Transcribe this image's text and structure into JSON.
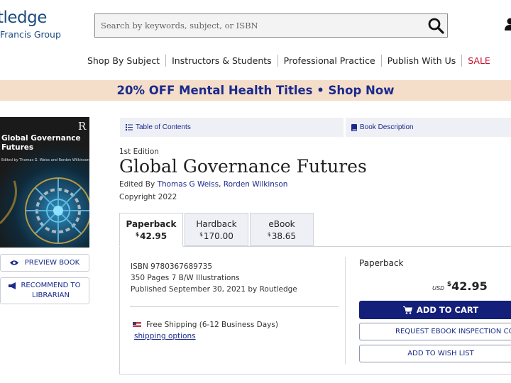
{
  "header": {
    "logo_text": "tledge",
    "logo_sub": "Francis Group",
    "search_placeholder": "Search by keywords, subject, or ISBN"
  },
  "nav": {
    "items": [
      "Shop By Subject",
      "Instructors & Students",
      "Professional Practice",
      "Publish With Us",
      "SALE"
    ]
  },
  "promo": {
    "text": "20% OFF Mental Health Titles • Shop Now"
  },
  "cover": {
    "title": "Global Governance Futures",
    "editors": "Edited by Thomas G. Weiss and Rorden Wilkinson",
    "publisher_mark": "R"
  },
  "sidebar": {
    "preview_label": "PREVIEW BOOK",
    "recommend_line1": "RECOMMEND TO",
    "recommend_line2": "LIBRARIAN"
  },
  "tabs": {
    "toc_label": "Table of Contents",
    "desc_label": "Book Description"
  },
  "book": {
    "edition": "1st Edition",
    "title": "Global Governance Futures",
    "edited_by_prefix": "Edited By",
    "editor1": "Thomas G Weiss",
    "editor_sep": ",",
    "editor2": "Rorden Wilkinson",
    "copyright": "Copyright 2022"
  },
  "formats": [
    {
      "name": "Paperback",
      "currency": "$",
      "price": "42.95",
      "selected": true
    },
    {
      "name": "Hardback",
      "currency": "$",
      "price": "170.00",
      "selected": false
    },
    {
      "name": "eBook",
      "currency": "$",
      "price": "38.65",
      "selected": false
    }
  ],
  "details": {
    "isbn": "ISBN 9780367689735",
    "pages": "350 Pages 7 B/W Illustrations",
    "published": "Published September 30, 2021 by Routledge",
    "shipping": "Free Shipping (6-12 Business Days)",
    "shipping_link": "shipping options"
  },
  "purchase": {
    "format_label": "Paperback",
    "currency_code": "USD",
    "currency_symbol": "$",
    "price": "42.95",
    "add_to_cart": "ADD TO CART",
    "inspection": "REQUEST EBOOK INSPECTION COPY",
    "wishlist": "ADD TO WISH LIST"
  },
  "colors": {
    "brand_navy": "#141f7a",
    "link_blue": "#1a2a8c",
    "promo_bg": "#f4ddc9",
    "sale_red": "#c8102e"
  },
  "icons": [
    "search-icon",
    "user-icon",
    "list-icon",
    "book-icon",
    "eye-icon",
    "megaphone-icon",
    "cart-icon",
    "us-flag-icon"
  ]
}
